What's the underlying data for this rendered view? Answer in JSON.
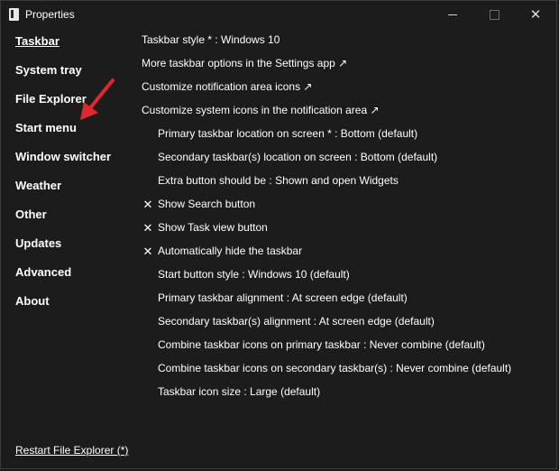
{
  "window": {
    "title": "Properties",
    "minimize_glyph": "",
    "close_glyph": "✕"
  },
  "sidebar": {
    "items": [
      {
        "label": "Taskbar",
        "active": true
      },
      {
        "label": "System tray",
        "active": false
      },
      {
        "label": "File Explorer",
        "active": false
      },
      {
        "label": "Start menu",
        "active": false
      },
      {
        "label": "Window switcher",
        "active": false
      },
      {
        "label": "Weather",
        "active": false
      },
      {
        "label": "Other",
        "active": false
      },
      {
        "label": "Updates",
        "active": false
      },
      {
        "label": "Advanced",
        "active": false
      },
      {
        "label": "About",
        "active": false
      }
    ],
    "restart_label": "Restart File Explorer (*)"
  },
  "settings": [
    {
      "label": "Taskbar style * : Windows 10",
      "checked": null
    },
    {
      "label": "More taskbar options in the Settings app ↗",
      "checked": null
    },
    {
      "label": "Customize notification area icons ↗",
      "checked": null
    },
    {
      "label": "Customize system icons in the notification area ↗",
      "checked": null
    },
    {
      "label": "Primary taskbar location on screen * : Bottom (default)",
      "checked": false
    },
    {
      "label": "Secondary taskbar(s) location on screen : Bottom (default)",
      "checked": false
    },
    {
      "label": "Extra button should be : Shown and open Widgets",
      "checked": false
    },
    {
      "label": "Show Search button",
      "checked": true
    },
    {
      "label": "Show Task view button",
      "checked": true
    },
    {
      "label": "Automatically hide the taskbar",
      "checked": true
    },
    {
      "label": "Start button style : Windows 10 (default)",
      "checked": false
    },
    {
      "label": "Primary taskbar alignment : At screen edge (default)",
      "checked": false
    },
    {
      "label": "Secondary taskbar(s) alignment : At screen edge (default)",
      "checked": false
    },
    {
      "label": "Combine taskbar icons on primary taskbar : Never combine (default)",
      "checked": false
    },
    {
      "label": "Combine taskbar icons on secondary taskbar(s) : Never combine (default)",
      "checked": false
    },
    {
      "label": "Taskbar icon size : Large (default)",
      "checked": false
    }
  ],
  "check_glyph": "✕",
  "colors": {
    "background": "#1c1c1c",
    "text": "#ffffff",
    "annotation_arrow": "#e0282c"
  },
  "annotation": {
    "icon": "red-arrow-pointing-to-start-menu"
  }
}
